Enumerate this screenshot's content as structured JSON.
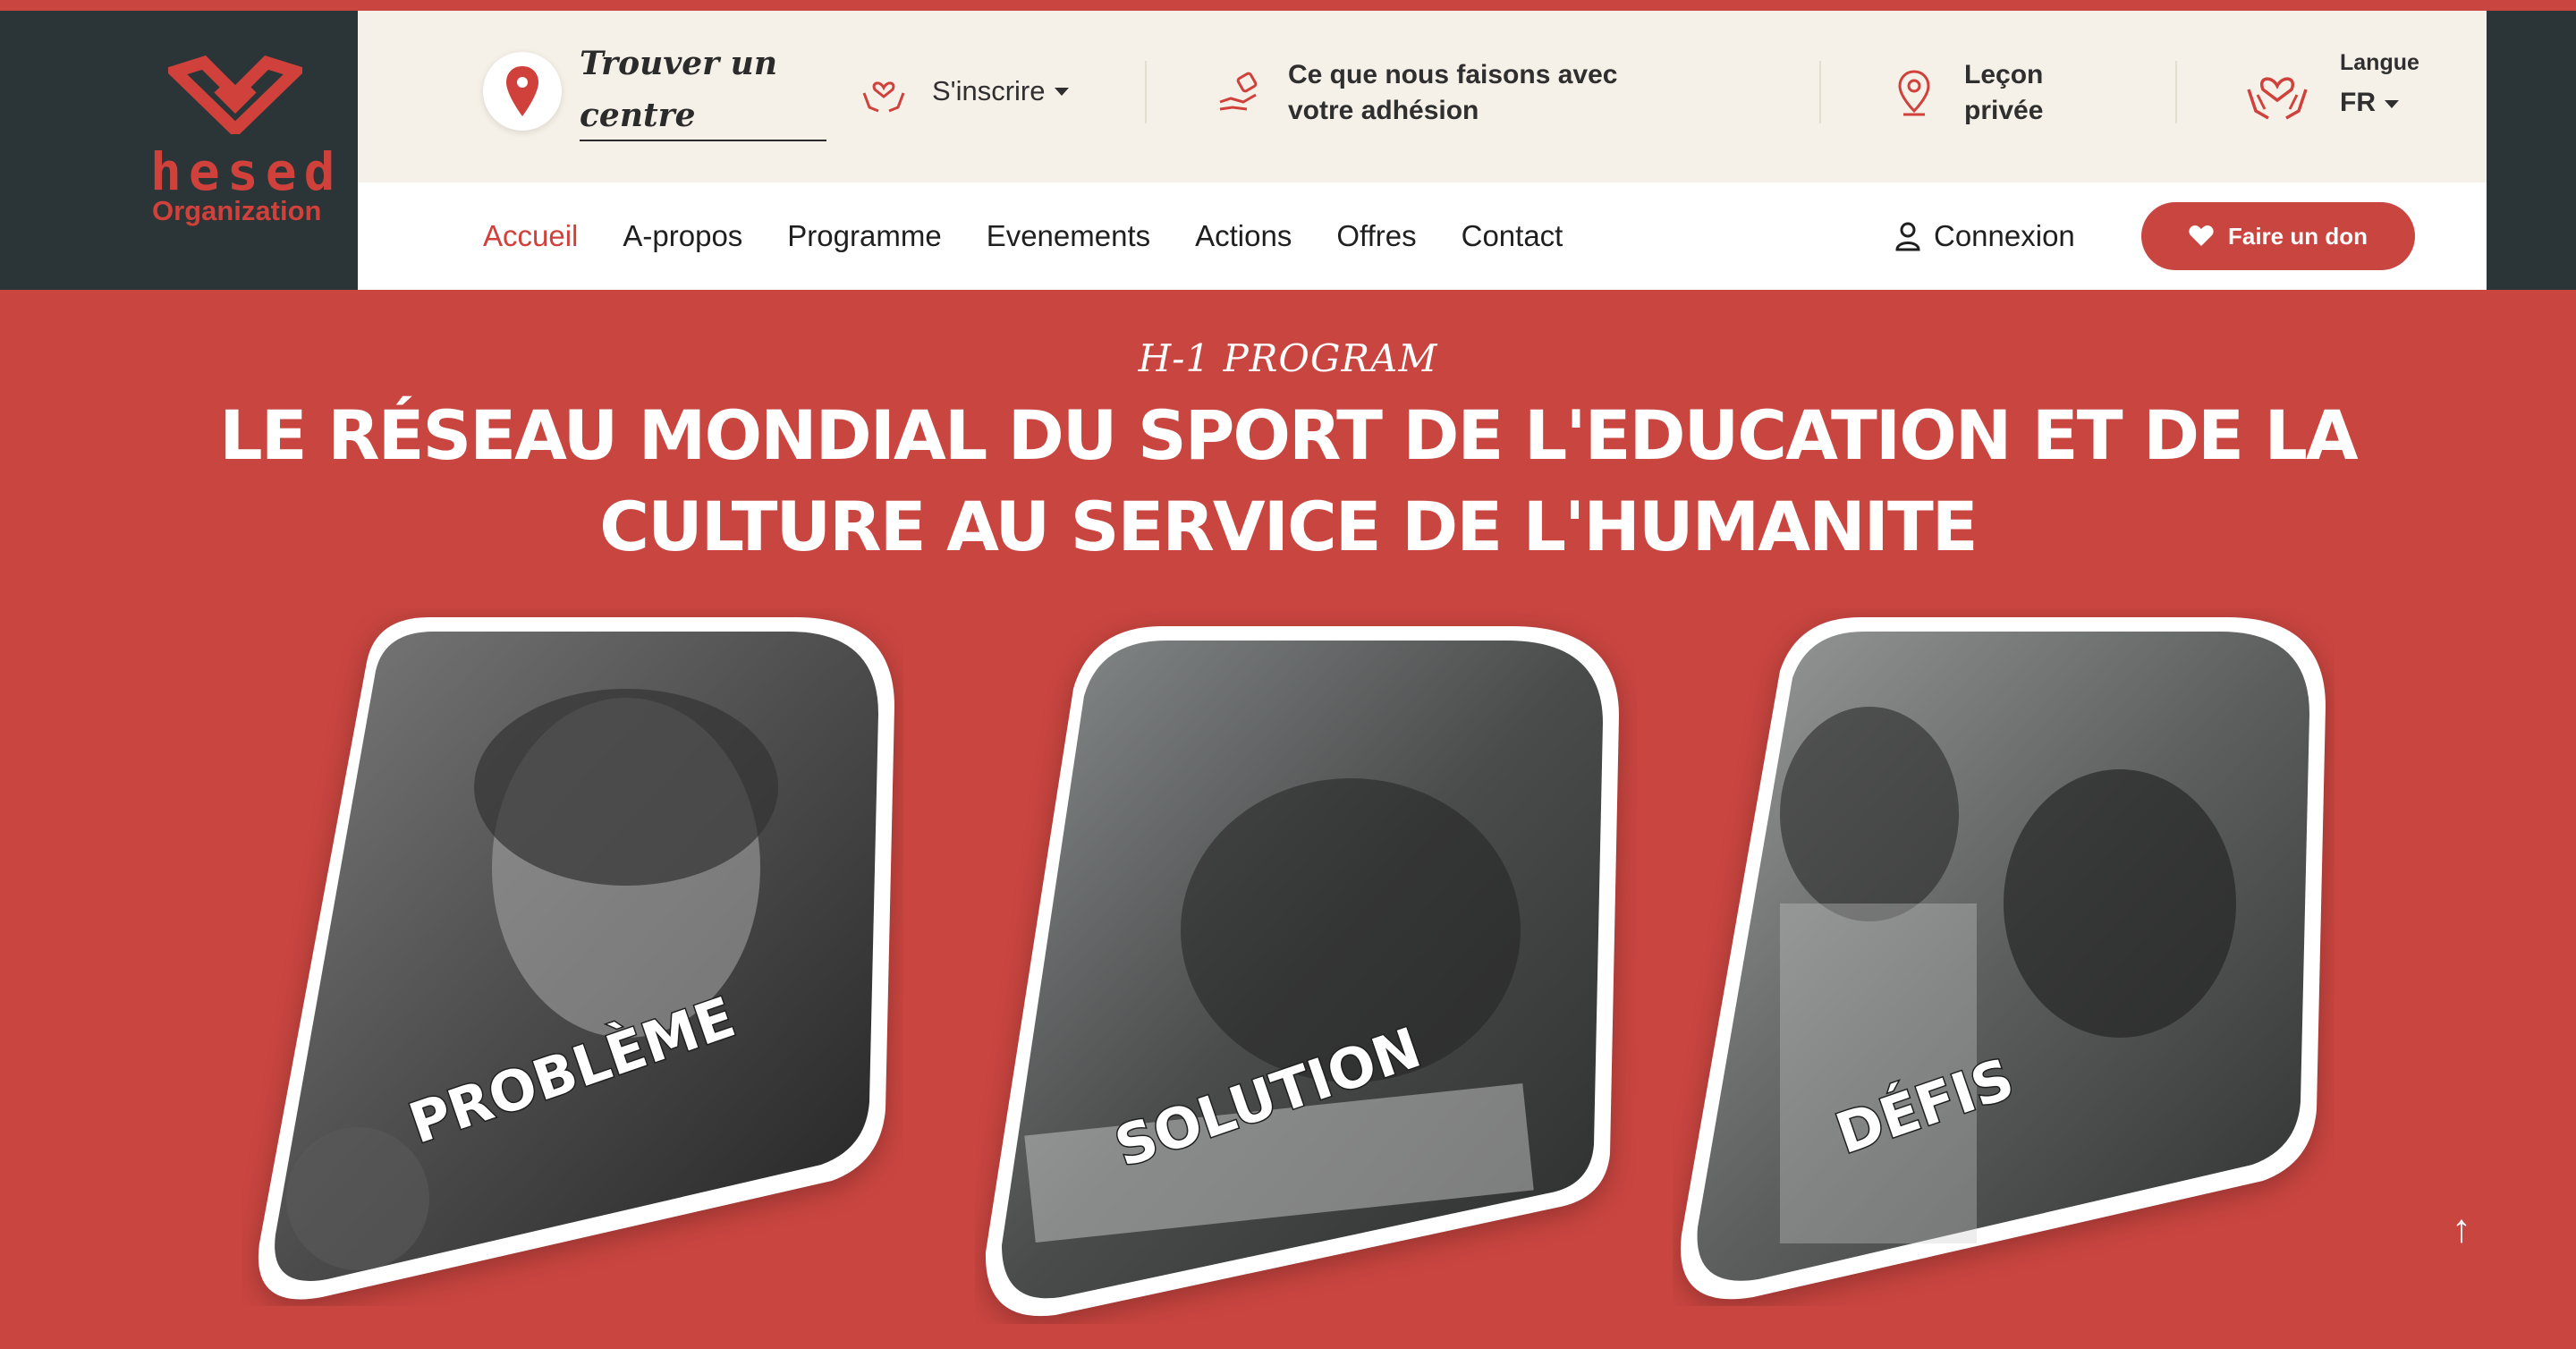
{
  "brand": {
    "name": "hesed",
    "sub": "Organization",
    "color": "#d0413b"
  },
  "header": {
    "find_center": {
      "line1": "Trouver un",
      "line2": "centre"
    },
    "signup_label": "S'inscrire",
    "membership_label": "Ce que nous faisons avec votre adhésion",
    "private_lesson_label": "Leçon privée",
    "language": {
      "label": "Langue",
      "value": "FR"
    }
  },
  "nav": {
    "items": [
      {
        "label": "Accueil",
        "active": true
      },
      {
        "label": "A-propos"
      },
      {
        "label": "Programme"
      },
      {
        "label": "Evenements"
      },
      {
        "label": "Actions"
      },
      {
        "label": "Offres"
      },
      {
        "label": "Contact"
      }
    ],
    "login_label": "Connexion",
    "donate_label": "Faire un don"
  },
  "hero": {
    "kicker": "H-1 PROGRAM",
    "title_line1": "LE RÉSEAU MONDIAL DU SPORT DE L'EDUCATION ET DE LA",
    "title_line2": "CULTURE AU SERVICE DE L'HUMANITE",
    "cards": [
      {
        "label": "PROBLÈME",
        "icon": "girl-smiling-photo"
      },
      {
        "label": "SOLUTION",
        "icon": "boy-writing-photo"
      },
      {
        "label": "DÉFIS",
        "icon": "children-smiling-photo"
      }
    ]
  },
  "colors": {
    "accent": "#c94540",
    "dark": "#2b3436",
    "cream": "#f6f1e8"
  },
  "scroll_top_icon": "arrow-up-icon"
}
